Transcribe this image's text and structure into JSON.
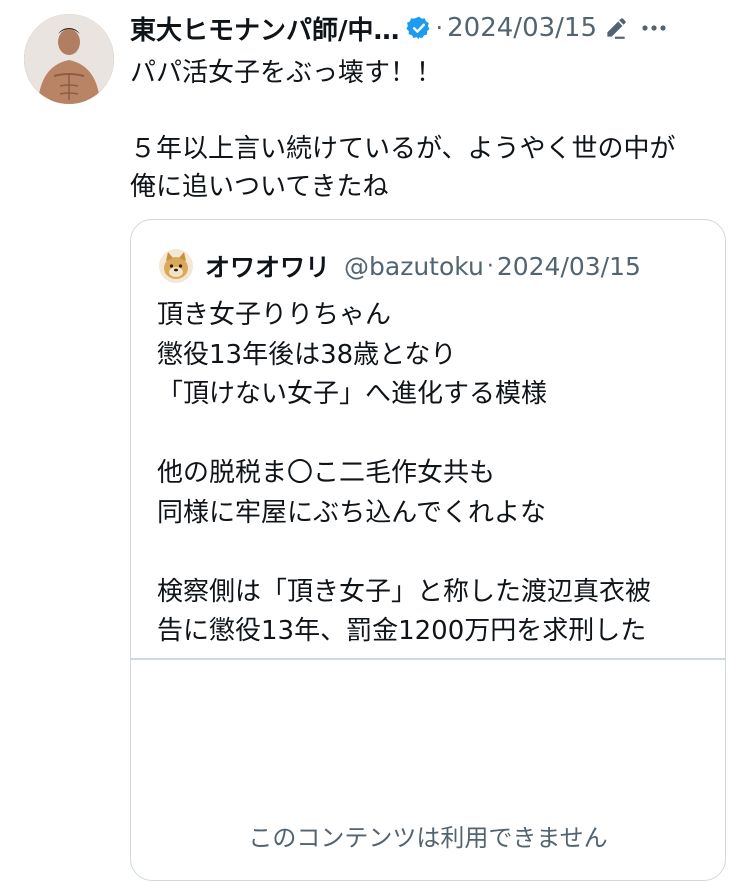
{
  "tweet": {
    "author_name": "東大ヒモナンパ師/中…",
    "date": "2024/03/15",
    "separator": "·",
    "text_lines": [
      "パパ活女子をぶっ壊す！！",
      "",
      "５年以上言い続けているが、ようやく世の中が",
      "俺に追いついてきたね"
    ]
  },
  "quote": {
    "author_name": "オワオワリ",
    "handle": "@bazutoku",
    "separator": "·",
    "date": "2024/03/15",
    "text_lines": [
      "頂き女子りりちゃん",
      "懲役13年後は38歳となり",
      "「頂けない女子」へ進化する模様",
      "",
      "他の脱税ま〇こ二毛作女共も",
      "同様に牢屋にぶち込んでくれよな",
      "",
      "検察側は「頂き女子」と称した渡辺真衣被",
      "告に懲役13年、罰金1200万円を求刑した"
    ],
    "media_unavailable": "このコンテンツは利用できません"
  },
  "icons": {
    "avatar": "avatar-man-shirtless",
    "verified": "verified-badge-icon",
    "edit": "edited-pencil-icon",
    "more": "more-options-icon",
    "quote_avatar": "doge-avatar"
  },
  "colors": {
    "verified": "#1d9bf0",
    "secondary_text": "#536471",
    "border": "#cfd9de",
    "text": "#0f1419"
  }
}
